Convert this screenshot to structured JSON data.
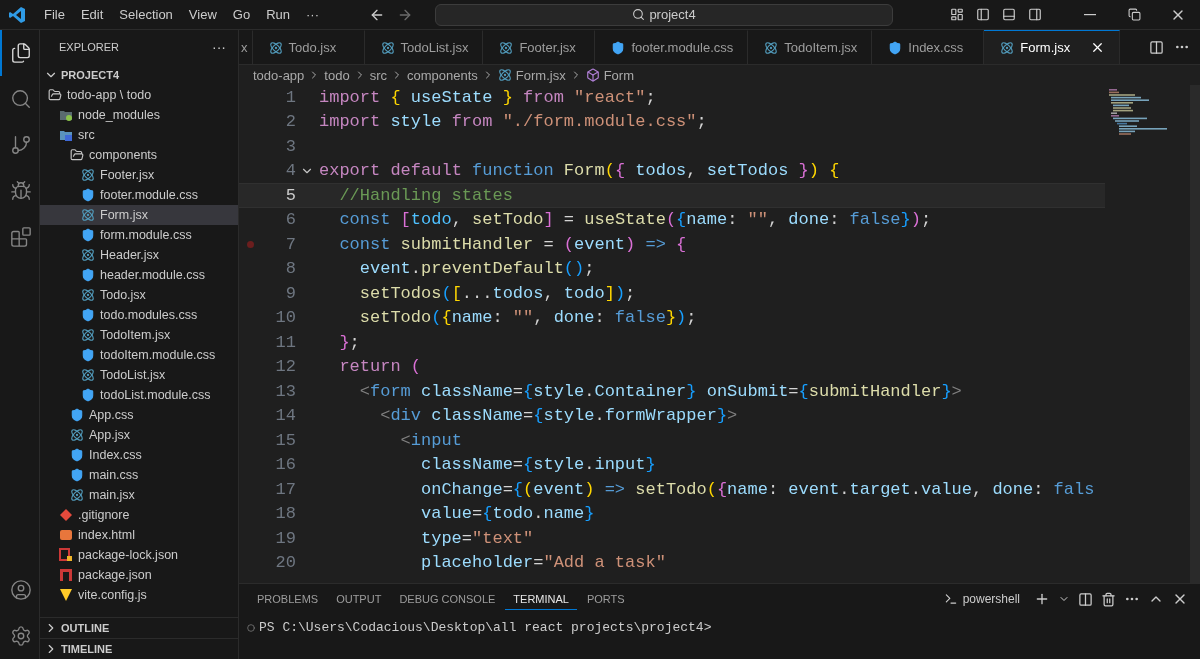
{
  "title_bar": {
    "menu": [
      "File",
      "Edit",
      "Selection",
      "View",
      "Go",
      "Run",
      "···"
    ],
    "search": {
      "value": "project4"
    }
  },
  "activity_bar": {
    "top": [
      {
        "kind": "files",
        "selected": true
      },
      {
        "kind": "search",
        "selected": false
      },
      {
        "kind": "source-control",
        "selected": false
      },
      {
        "kind": "run",
        "selected": false
      },
      {
        "kind": "extensions",
        "selected": false
      }
    ],
    "bottom": [
      {
        "kind": "account"
      },
      {
        "kind": "settings"
      }
    ]
  },
  "sidebar": {
    "title": "EXPLORER",
    "more": "···",
    "section": {
      "label": "PROJECT4",
      "expanded": true
    },
    "tree": [
      {
        "name": "todo-app \\ todo",
        "kind": "folder",
        "expanded": true,
        "selected": false,
        "children": [
          {
            "name": "node_modules",
            "kind": "modules",
            "selected": false
          },
          {
            "name": "src",
            "kind": "src",
            "expanded": true,
            "selected": false,
            "children": [
              {
                "name": "components",
                "kind": "folder",
                "expanded": true,
                "selected": false,
                "children": [
                  {
                    "name": "Footer.jsx",
                    "kind": "react",
                    "selected": false
                  },
                  {
                    "name": "footer.module.css",
                    "kind": "css",
                    "selected": false
                  },
                  {
                    "name": "Form.jsx",
                    "kind": "react",
                    "selected": true
                  },
                  {
                    "name": "form.module.css",
                    "kind": "css",
                    "selected": false
                  },
                  {
                    "name": "Header.jsx",
                    "kind": "react",
                    "selected": false
                  },
                  {
                    "name": "header.module.css",
                    "kind": "css",
                    "selected": false
                  },
                  {
                    "name": "Todo.jsx",
                    "kind": "react",
                    "selected": false
                  },
                  {
                    "name": "todo.modules.css",
                    "kind": "css",
                    "selected": false
                  },
                  {
                    "name": "TodoItem.jsx",
                    "kind": "react",
                    "selected": false
                  },
                  {
                    "name": "todoItem.module.css",
                    "kind": "css",
                    "selected": false
                  },
                  {
                    "name": "TodoList.jsx",
                    "kind": "react",
                    "selected": false
                  },
                  {
                    "name": "todoList.module.css",
                    "kind": "css",
                    "selected": false
                  }
                ]
              },
              {
                "name": "App.css",
                "kind": "css",
                "selected": false
              },
              {
                "name": "App.jsx",
                "kind": "react",
                "selected": false
              },
              {
                "name": "Index.css",
                "kind": "css",
                "selected": false
              },
              {
                "name": "main.css",
                "kind": "css",
                "selected": false
              },
              {
                "name": "main.jsx",
                "kind": "react",
                "selected": false
              }
            ]
          },
          {
            "name": ".gitignore",
            "kind": "git",
            "selected": false
          },
          {
            "name": "index.html",
            "kind": "html",
            "selected": false
          },
          {
            "name": "package-lock.json",
            "kind": "lock",
            "selected": false
          },
          {
            "name": "package.json",
            "kind": "npm",
            "selected": false
          },
          {
            "name": "vite.config.js",
            "kind": "vite",
            "selected": false
          }
        ]
      }
    ],
    "collapsed_sections": [
      "OUTLINE",
      "TIMELINE"
    ]
  },
  "editor": {
    "tabs": [
      {
        "label": "x",
        "selected": false
      },
      {
        "label": "Todo.jsx",
        "kind": "react",
        "selected": false
      },
      {
        "label": "TodoList.jsx",
        "kind": "react",
        "selected": false
      },
      {
        "label": "Footer.jsx",
        "kind": "react",
        "selected": false
      },
      {
        "label": "footer.module.css",
        "kind": "css",
        "selected": false
      },
      {
        "label": "TodoItem.jsx",
        "kind": "react",
        "selected": false
      },
      {
        "label": "Index.css",
        "kind": "css",
        "selected": false
      },
      {
        "label": "Form.jsx",
        "kind": "react",
        "selected": true
      }
    ],
    "breadcrumbs": [
      {
        "label": "todo-app",
        "kind": "folder"
      },
      {
        "label": "todo",
        "kind": "folder"
      },
      {
        "label": "src",
        "kind": "folder"
      },
      {
        "label": "components",
        "kind": "folder"
      },
      {
        "label": "Form.jsx",
        "kind": "react"
      },
      {
        "label": "Form",
        "kind": "symbol"
      }
    ],
    "lines": [
      {
        "number": "1",
        "current": false,
        "fold": false,
        "breakpoint": false,
        "segments": [
          {
            "text": "import",
            "kind": "kw"
          },
          {
            "text": " {",
            "kind": "b1"
          },
          {
            "text": " useState",
            "kind": "v"
          },
          {
            "text": " }",
            "kind": "b1"
          },
          {
            "text": " from",
            "kind": "kw"
          },
          {
            "text": " \"react\"",
            "kind": "s"
          },
          {
            "text": ";",
            "kind": "p"
          }
        ]
      },
      {
        "number": "2",
        "current": false,
        "fold": false,
        "breakpoint": false,
        "segments": [
          {
            "text": "import",
            "kind": "kw"
          },
          {
            "text": " style ",
            "kind": "v"
          },
          {
            "text": "from",
            "kind": "kw"
          },
          {
            "text": " \"./form.module.css\"",
            "kind": "s"
          },
          {
            "text": ";",
            "kind": "p"
          }
        ]
      },
      {
        "number": "3",
        "current": false,
        "fold": false,
        "breakpoint": false
      },
      {
        "number": "4",
        "current": false,
        "fold": true,
        "breakpoint": false,
        "segments": [
          {
            "text": "export",
            "kind": "kw"
          },
          {
            "text": " default",
            "kind": "kw"
          },
          {
            "text": " function",
            "kind": "st"
          },
          {
            "text": " Form",
            "kind": "fn"
          },
          {
            "text": "(",
            "kind": "b1"
          },
          {
            "text": "{",
            "kind": "b2"
          },
          {
            "text": " todos",
            "kind": "v"
          },
          {
            "text": ",",
            "kind": "p"
          },
          {
            "text": " setTodos",
            "kind": "v"
          },
          {
            "text": " }",
            "kind": "b2"
          },
          {
            "text": ")",
            "kind": "b1"
          },
          {
            "text": " {",
            "kind": "b1"
          }
        ]
      },
      {
        "number": "5",
        "current": true,
        "fold": false,
        "breakpoint": false,
        "segments": [
          {
            "text": "  //Handling states",
            "kind": "cm"
          }
        ]
      },
      {
        "number": "6",
        "current": false,
        "fold": false,
        "breakpoint": false,
        "segments": [
          {
            "text": "  const",
            "kind": "st"
          },
          {
            "text": " [",
            "kind": "b2"
          },
          {
            "text": "todo",
            "kind": "c"
          },
          {
            "text": ",",
            "kind": "p"
          },
          {
            "text": " setTodo",
            "kind": "fn"
          },
          {
            "text": "]",
            "kind": "b2"
          },
          {
            "text": " =",
            "kind": "p"
          },
          {
            "text": " useState",
            "kind": "fn"
          },
          {
            "text": "(",
            "kind": "b2"
          },
          {
            "text": "{",
            "kind": "b3"
          },
          {
            "text": "name",
            "kind": "v"
          },
          {
            "text": ":",
            "kind": "p"
          },
          {
            "text": " \"\"",
            "kind": "s"
          },
          {
            "text": ",",
            "kind": "p"
          },
          {
            "text": " done",
            "kind": "v"
          },
          {
            "text": ":",
            "kind": "p"
          },
          {
            "text": " false",
            "kind": "st"
          },
          {
            "text": "}",
            "kind": "b3"
          },
          {
            "text": ")",
            "kind": "b2"
          },
          {
            "text": ";",
            "kind": "p"
          }
        ]
      },
      {
        "number": "7",
        "current": false,
        "fold": false,
        "breakpoint": true,
        "segments": [
          {
            "text": "  const",
            "kind": "st"
          },
          {
            "text": " submitHandler",
            "kind": "fn"
          },
          {
            "text": " =",
            "kind": "p"
          },
          {
            "text": " (",
            "kind": "b2"
          },
          {
            "text": "event",
            "kind": "v"
          },
          {
            "text": ")",
            "kind": "b2"
          },
          {
            "text": " =>",
            "kind": "st"
          },
          {
            "text": " {",
            "kind": "b2"
          }
        ]
      },
      {
        "number": "8",
        "current": false,
        "fold": false,
        "breakpoint": false,
        "segments": [
          {
            "text": "    event",
            "kind": "v"
          },
          {
            "text": ".",
            "kind": "p"
          },
          {
            "text": "preventDefault",
            "kind": "fn"
          },
          {
            "text": "()",
            "kind": "b3"
          },
          {
            "text": ";",
            "kind": "p"
          }
        ]
      },
      {
        "number": "9",
        "current": false,
        "fold": false,
        "breakpoint": false,
        "segments": [
          {
            "text": "    setTodos",
            "kind": "fn"
          },
          {
            "text": "(",
            "kind": "b3"
          },
          {
            "text": "[",
            "kind": "b1"
          },
          {
            "text": "...",
            "kind": "p"
          },
          {
            "text": "todos",
            "kind": "v"
          },
          {
            "text": ",",
            "kind": "p"
          },
          {
            "text": " todo",
            "kind": "v"
          },
          {
            "text": "]",
            "kind": "b1"
          },
          {
            "text": ")",
            "kind": "b3"
          },
          {
            "text": ";",
            "kind": "p"
          }
        ]
      },
      {
        "number": "10",
        "current": false,
        "fold": false,
        "breakpoint": false,
        "segments": [
          {
            "text": "    setTodo",
            "kind": "fn"
          },
          {
            "text": "(",
            "kind": "b3"
          },
          {
            "text": "{",
            "kind": "b1"
          },
          {
            "text": "name",
            "kind": "v"
          },
          {
            "text": ":",
            "kind": "p"
          },
          {
            "text": " \"\"",
            "kind": "s"
          },
          {
            "text": ",",
            "kind": "p"
          },
          {
            "text": " done",
            "kind": "v"
          },
          {
            "text": ":",
            "kind": "p"
          },
          {
            "text": " false",
            "kind": "st"
          },
          {
            "text": "}",
            "kind": "b1"
          },
          {
            "text": ")",
            "kind": "b3"
          },
          {
            "text": ";",
            "kind": "p"
          }
        ]
      },
      {
        "number": "11",
        "current": false,
        "fold": false,
        "breakpoint": false,
        "segments": [
          {
            "text": "  }",
            "kind": "b2"
          },
          {
            "text": ";",
            "kind": "p"
          }
        ]
      },
      {
        "number": "12",
        "current": false,
        "fold": false,
        "breakpoint": false,
        "segments": [
          {
            "text": "  return",
            "kind": "kw"
          },
          {
            "text": " (",
            "kind": "b2"
          }
        ]
      },
      {
        "number": "13",
        "current": false,
        "fold": false,
        "breakpoint": false,
        "segments": [
          {
            "text": "    <",
            "kind": "g"
          },
          {
            "text": "form",
            "kind": "tag"
          },
          {
            "text": " className",
            "kind": "v"
          },
          {
            "text": "=",
            "kind": "p"
          },
          {
            "text": "{",
            "kind": "b3"
          },
          {
            "text": "style",
            "kind": "v"
          },
          {
            "text": ".",
            "kind": "p"
          },
          {
            "text": "Container",
            "kind": "v"
          },
          {
            "text": "}",
            "kind": "b3"
          },
          {
            "text": " onSubmit",
            "kind": "v"
          },
          {
            "text": "=",
            "kind": "p"
          },
          {
            "text": "{",
            "kind": "b3"
          },
          {
            "text": "submitHandler",
            "kind": "fn"
          },
          {
            "text": "}",
            "kind": "b3"
          },
          {
            "text": ">",
            "kind": "g"
          }
        ]
      },
      {
        "number": "14",
        "current": false,
        "fold": false,
        "breakpoint": false,
        "segments": [
          {
            "text": "      <",
            "kind": "g"
          },
          {
            "text": "div",
            "kind": "tag"
          },
          {
            "text": " className",
            "kind": "v"
          },
          {
            "text": "=",
            "kind": "p"
          },
          {
            "text": "{",
            "kind": "b3"
          },
          {
            "text": "style",
            "kind": "v"
          },
          {
            "text": ".",
            "kind": "p"
          },
          {
            "text": "formWrapper",
            "kind": "v"
          },
          {
            "text": "}",
            "kind": "b3"
          },
          {
            "text": ">",
            "kind": "g"
          }
        ]
      },
      {
        "number": "15",
        "current": false,
        "fold": false,
        "breakpoint": false,
        "segments": [
          {
            "text": "        <",
            "kind": "g"
          },
          {
            "text": "input",
            "kind": "tag"
          }
        ]
      },
      {
        "number": "16",
        "current": false,
        "fold": false,
        "breakpoint": false,
        "segments": [
          {
            "text": "          className",
            "kind": "v"
          },
          {
            "text": "=",
            "kind": "p"
          },
          {
            "text": "{",
            "kind": "b3"
          },
          {
            "text": "style",
            "kind": "v"
          },
          {
            "text": ".",
            "kind": "p"
          },
          {
            "text": "input",
            "kind": "v"
          },
          {
            "text": "}",
            "kind": "b3"
          }
        ]
      },
      {
        "number": "17",
        "current": false,
        "fold": false,
        "breakpoint": false,
        "segments": [
          {
            "text": "          onChange",
            "kind": "v"
          },
          {
            "text": "=",
            "kind": "p"
          },
          {
            "text": "{",
            "kind": "b3"
          },
          {
            "text": "(",
            "kind": "b1"
          },
          {
            "text": "event",
            "kind": "v"
          },
          {
            "text": ")",
            "kind": "b1"
          },
          {
            "text": " =>",
            "kind": "st"
          },
          {
            "text": " setTodo",
            "kind": "fn"
          },
          {
            "text": "(",
            "kind": "b1"
          },
          {
            "text": "{",
            "kind": "b2"
          },
          {
            "text": "name",
            "kind": "v"
          },
          {
            "text": ":",
            "kind": "p"
          },
          {
            "text": " event",
            "kind": "v"
          },
          {
            "text": ".",
            "kind": "p"
          },
          {
            "text": "target",
            "kind": "v"
          },
          {
            "text": ".",
            "kind": "p"
          },
          {
            "text": "value",
            "kind": "v"
          },
          {
            "text": ",",
            "kind": "p"
          },
          {
            "text": " done",
            "kind": "v"
          },
          {
            "text": ":",
            "kind": "p"
          },
          {
            "text": " fals",
            "kind": "st"
          }
        ]
      },
      {
        "number": "18",
        "current": false,
        "fold": false,
        "breakpoint": false,
        "segments": [
          {
            "text": "          value",
            "kind": "v"
          },
          {
            "text": "=",
            "kind": "p"
          },
          {
            "text": "{",
            "kind": "b3"
          },
          {
            "text": "todo",
            "kind": "v"
          },
          {
            "text": ".",
            "kind": "p"
          },
          {
            "text": "name",
            "kind": "v"
          },
          {
            "text": "}",
            "kind": "b3"
          }
        ]
      },
      {
        "number": "19",
        "current": false,
        "fold": false,
        "breakpoint": false,
        "segments": [
          {
            "text": "          type",
            "kind": "v"
          },
          {
            "text": "=",
            "kind": "p"
          },
          {
            "text": "\"text\"",
            "kind": "s"
          }
        ]
      },
      {
        "number": "20",
        "current": false,
        "fold": false,
        "breakpoint": false,
        "segments": [
          {
            "text": "          placeholder",
            "kind": "v"
          },
          {
            "text": "=",
            "kind": "p"
          },
          {
            "text": "\"Add a task\"",
            "kind": "s"
          }
        ]
      }
    ]
  },
  "panel": {
    "tabs": [
      {
        "label": "PROBLEMS",
        "selected": false
      },
      {
        "label": "OUTPUT",
        "selected": false
      },
      {
        "label": "DEBUG CONSOLE",
        "selected": false
      },
      {
        "label": "TERMINAL",
        "selected": true
      },
      {
        "label": "PORTS",
        "selected": false
      }
    ],
    "shell": "powershell",
    "prompt": "PS C:\\Users\\Codacious\\Desktop\\all react projects\\project4>"
  }
}
